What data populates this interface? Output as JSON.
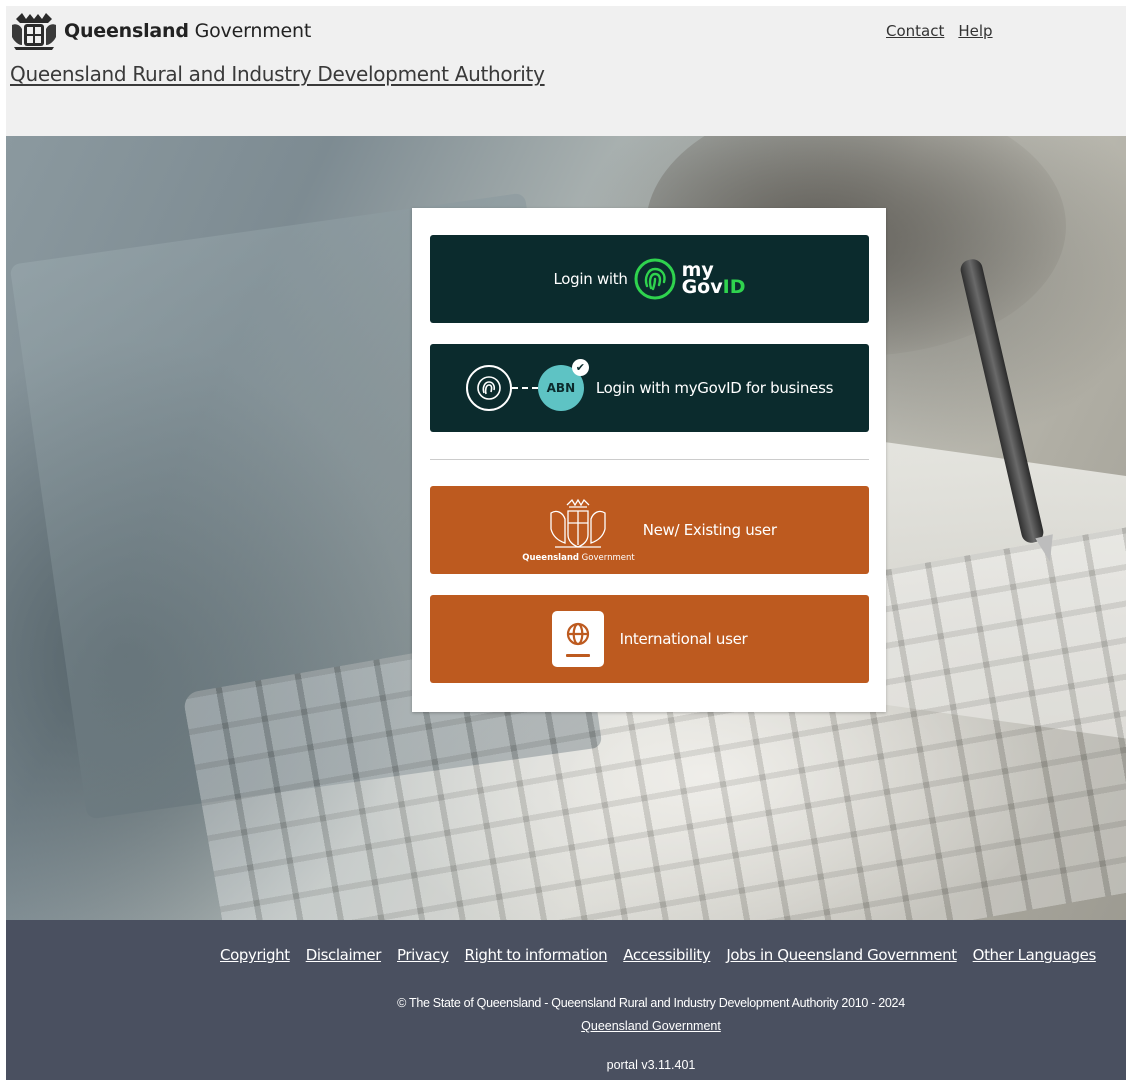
{
  "header": {
    "brand_bold": "Queensland",
    "brand_light": "Government",
    "site_title": "Queensland Rural and Industry Development Authority",
    "links": [
      "Contact",
      "Help"
    ]
  },
  "login": {
    "mygovid_prefix": "Login with",
    "mygovid_logo_my": "my",
    "mygovid_logo_gov": "Gov",
    "mygovid_logo_id": "ID",
    "business_abn_badge": "ABN",
    "business_label": "Login with myGovID for business",
    "existing_logo_caption_bold": "Queensland",
    "existing_logo_caption_light": "Government",
    "existing_label": "New/ Existing user",
    "international_label": "International user"
  },
  "icons": [
    "qld-crest-icon",
    "fingerprint-icon",
    "abn-check-icon",
    "globe-icon"
  ],
  "colors": {
    "header_bg": "#f0f0f0",
    "dark_button": "#0b2b2d",
    "orange_button": "#bd5a1f",
    "mygovid_green": "#2fd34e",
    "abn_teal": "#5ec3c4",
    "footer_bg": "#4a5060"
  },
  "footer": {
    "links": [
      "Copyright",
      "Disclaimer",
      "Privacy",
      "Right to information",
      "Accessibility",
      "Jobs in Queensland Government",
      "Other Languages"
    ],
    "copyright": "© The State of Queensland - Queensland Rural and Industry Development Authority 2010 - 2024",
    "qg_link": "Queensland Government",
    "version": "portal v3.11.401"
  }
}
